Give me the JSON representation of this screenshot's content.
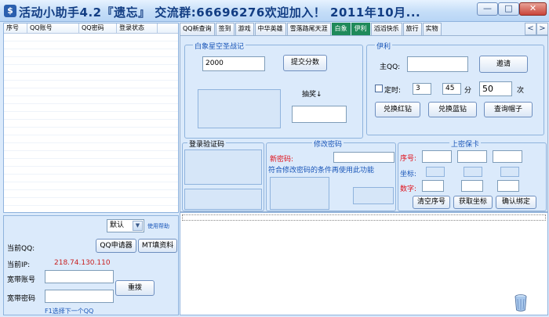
{
  "window": {
    "title": "活动小助手4.2『遗忘』 交流群:66696276欢迎加入！   2011年10月...",
    "icon_glyph": "$",
    "btn_min": "—",
    "btn_max": "□",
    "btn_close": "✕"
  },
  "account_list": {
    "columns": [
      "序号",
      "QQ账号",
      "QQ密码",
      "登录状态"
    ]
  },
  "left_panel": {
    "mode_value": "默认",
    "help_link": "使用帮助",
    "current_qq_label": "当前QQ:",
    "qq_apply_button": "QQ申请器",
    "fill_info_button": "MT填资料",
    "current_ip_label": "当前IP:",
    "current_ip_value": "218.74.130.110",
    "broadband_account_label": "宽带账号",
    "broadband_password_label": "宽带密码",
    "redial_button": "重拨",
    "hint": "F1选择下一个QQ"
  },
  "tabs": [
    {
      "label": "QQ新查询",
      "active": false
    },
    {
      "label": "签到",
      "active": false
    },
    {
      "label": "游戏",
      "active": false
    },
    {
      "label": "中华英雄",
      "active": false
    },
    {
      "label": "雪落路尾天涯",
      "active": false
    },
    {
      "label": "白象",
      "active": true
    },
    {
      "label": "伊利",
      "active": true
    },
    {
      "label": "滔滔快乐",
      "active": false
    },
    {
      "label": "旅行",
      "active": false
    },
    {
      "label": "实物",
      "active": false
    }
  ],
  "tab_scroll": {
    "left": "<",
    "right": ">"
  },
  "baixiang": {
    "group_title": "白象星空圣战记",
    "score_value": "2000",
    "submit_button": "提交分数",
    "lottery_label": "抽奖↓"
  },
  "yili": {
    "group_title": "伊利",
    "main_qq_label": "主QQ:",
    "invite_button": "邀请",
    "timer_label": "定时:",
    "timer_value": "3",
    "minute_value": "45",
    "minute_label": "分",
    "count_value": "50",
    "count_label": "次",
    "red_diamond_button": "兑换红钻",
    "blue_diamond_button": "兑换蓝钻",
    "hat_button": "查询帽子"
  },
  "login_captcha": {
    "group_title": "登录验证码"
  },
  "change_password": {
    "group_title": "修改密码",
    "new_password_label": "新密码:",
    "condition_text": "符合修改密码的条件再使用此功能"
  },
  "security_card": {
    "group_title": "上密保卡",
    "seq_label": "序号:",
    "coord_label": "坐标:",
    "digit_label": "数字:",
    "clear_button": "清空序号",
    "get_coord_button": "获取坐标",
    "bind_button": "确认绑定"
  },
  "colors": {
    "title_text": "#123d83",
    "active_tab": "#1f8a5a",
    "ip_text": "#c81e1e",
    "red_label": "#e0101a",
    "blue_label": "#1a56b8"
  }
}
